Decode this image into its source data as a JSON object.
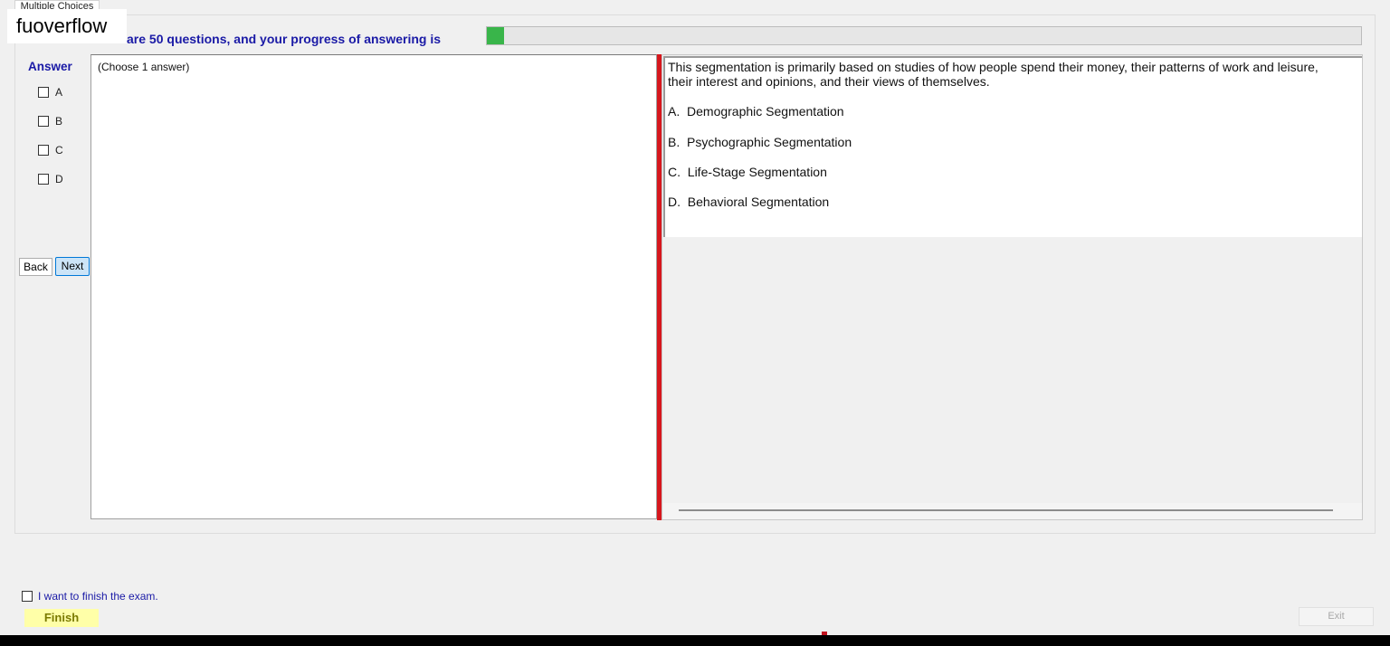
{
  "tab": {
    "label": "Multiple Choices"
  },
  "watermark": {
    "text": "fuoverflow"
  },
  "progress": {
    "title": "There are 50 questions, and your progress of answering is",
    "value_percent": 2
  },
  "answer": {
    "label": "Answer",
    "options": [
      {
        "label": "A",
        "checked": false
      },
      {
        "label": "B",
        "checked": false
      },
      {
        "label": "C",
        "checked": false
      },
      {
        "label": "D",
        "checked": false
      }
    ]
  },
  "nav": {
    "back_label": "Back",
    "next_label": "Next"
  },
  "left_pane": {
    "hint": "(Choose 1 answer)"
  },
  "question": {
    "text": "This segmentation is primarily based on studies of how people spend their money, their patterns of work and leisure, their interest and opinions, and their views of themselves.",
    "choices": [
      "A.  Demographic Segmentation",
      "B.  Psychographic Segmentation",
      "C.  Life-Stage Segmentation",
      "D.  Behavioral Segmentation"
    ]
  },
  "finish": {
    "checkbox_label": "I want to finish the exam.",
    "finish_label": "Finish",
    "exit_label": "Exit"
  },
  "colors": {
    "accent_blue": "#1a1aa6",
    "splitter_red": "#d6171d",
    "progress_green": "#39b54a",
    "finish_yellow": "#ffffa8"
  }
}
